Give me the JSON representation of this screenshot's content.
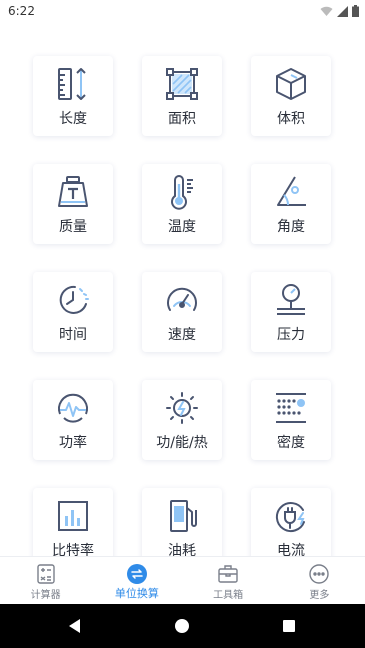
{
  "status_bar": {
    "time": "6:22"
  },
  "colors": {
    "accent": "#2f8be8",
    "icon_stroke": "#4a5570",
    "icon_light": "#8fc4f5"
  },
  "grid": {
    "items": [
      {
        "label": "长度",
        "icon": "ruler-icon"
      },
      {
        "label": "面积",
        "icon": "area-square-icon"
      },
      {
        "label": "体积",
        "icon": "cube-icon"
      },
      {
        "label": "质量",
        "icon": "weight-icon"
      },
      {
        "label": "温度",
        "icon": "thermometer-icon"
      },
      {
        "label": "角度",
        "icon": "angle-icon"
      },
      {
        "label": "时间",
        "icon": "clock-icon"
      },
      {
        "label": "速度",
        "icon": "speedometer-icon"
      },
      {
        "label": "压力",
        "icon": "pressure-gauge-icon"
      },
      {
        "label": "功率",
        "icon": "power-meter-icon"
      },
      {
        "label": "功/能/热",
        "icon": "energy-sun-icon"
      },
      {
        "label": "密度",
        "icon": "density-dots-icon"
      },
      {
        "label": "比特率",
        "icon": "bitrate-chart-icon"
      },
      {
        "label": "油耗",
        "icon": "fuel-pump-icon"
      },
      {
        "label": "电流",
        "icon": "plug-icon"
      }
    ]
  },
  "bottom_nav": {
    "items": [
      {
        "label": "计算器",
        "icon": "calculator-icon"
      },
      {
        "label": "单位换算",
        "icon": "unit-convert-icon"
      },
      {
        "label": "工具箱",
        "icon": "toolbox-icon"
      },
      {
        "label": "更多",
        "icon": "more-icon"
      }
    ]
  }
}
